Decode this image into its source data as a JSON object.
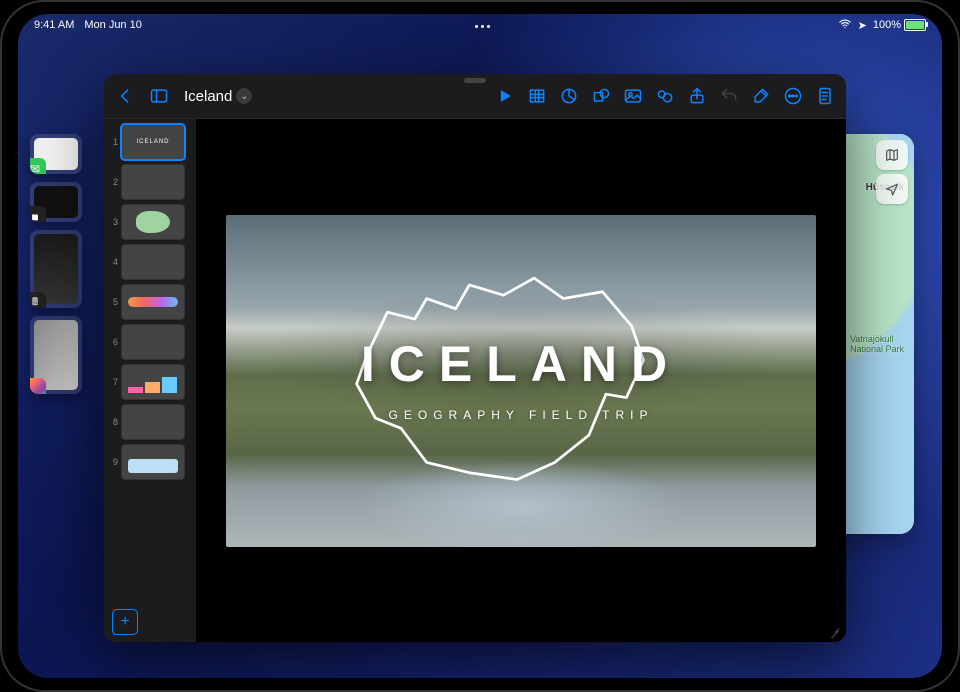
{
  "status": {
    "time": "9:41 AM",
    "date": "Mon Jun 10",
    "battery_pct": "100%"
  },
  "stage_apps": [
    {
      "name": "Messages"
    },
    {
      "name": "FaceTime"
    },
    {
      "name": "Calculator"
    },
    {
      "name": "Photos"
    }
  ],
  "keynote": {
    "doc_title": "Iceland",
    "toolbar": {
      "back": "Back",
      "sidebar": "Sidebar",
      "play": "Play",
      "table": "Table",
      "chart": "Chart",
      "shape": "Shape",
      "media": "Media",
      "text_box": "Text",
      "share": "Share",
      "undo": "Undo",
      "format": "Format",
      "more": "More",
      "document": "Document"
    },
    "slides": [
      {
        "n": "1",
        "kind": "m-iceland",
        "selected": true
      },
      {
        "n": "2",
        "kind": "m-collage"
      },
      {
        "n": "3",
        "kind": "m-map"
      },
      {
        "n": "4",
        "kind": "m-aurora"
      },
      {
        "n": "5",
        "kind": "m-flow"
      },
      {
        "n": "6",
        "kind": "m-volcano"
      },
      {
        "n": "7",
        "kind": "m-chart"
      },
      {
        "n": "8",
        "kind": "m-ice"
      },
      {
        "n": "9",
        "kind": "m-info"
      }
    ],
    "add_slide": "+",
    "current_slide": {
      "title": "ICELAND",
      "subtitle": "GEOGRAPHY FIELD TRIP"
    }
  },
  "maps": {
    "city": "Húsavík",
    "park": "Vatnajökull\nNational Park",
    "controls": {
      "map_mode": "Map mode",
      "location": "Location"
    }
  }
}
